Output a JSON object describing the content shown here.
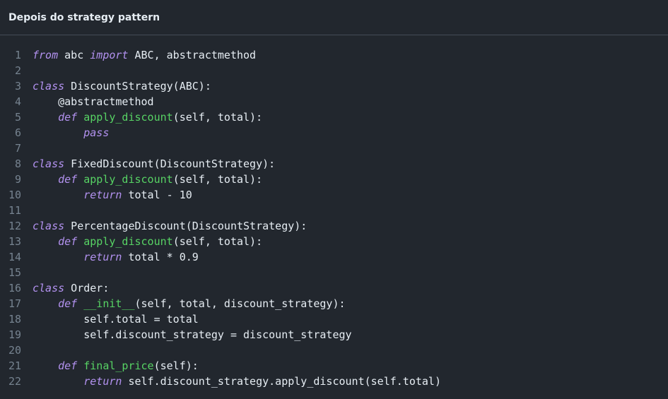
{
  "header": {
    "title": "Depois do strategy pattern"
  },
  "code_lines": [
    {
      "n": "1",
      "tokens": [
        {
          "t": "kw",
          "v": "from"
        },
        {
          "t": "plain",
          "v": " abc "
        },
        {
          "t": "kw",
          "v": "import"
        },
        {
          "t": "plain",
          "v": " ABC, abstractmethod"
        }
      ]
    },
    {
      "n": "2",
      "tokens": []
    },
    {
      "n": "3",
      "tokens": [
        {
          "t": "kw",
          "v": "class"
        },
        {
          "t": "plain",
          "v": " DiscountStrategy(ABC):"
        }
      ]
    },
    {
      "n": "4",
      "tokens": [
        {
          "t": "plain",
          "v": "    @abstractmethod"
        }
      ]
    },
    {
      "n": "5",
      "tokens": [
        {
          "t": "plain",
          "v": "    "
        },
        {
          "t": "kw",
          "v": "def"
        },
        {
          "t": "plain",
          "v": " "
        },
        {
          "t": "fn",
          "v": "apply_discount"
        },
        {
          "t": "plain",
          "v": "(self, total):"
        }
      ]
    },
    {
      "n": "6",
      "tokens": [
        {
          "t": "plain",
          "v": "        "
        },
        {
          "t": "kw",
          "v": "pass"
        }
      ]
    },
    {
      "n": "7",
      "tokens": []
    },
    {
      "n": "8",
      "tokens": [
        {
          "t": "kw",
          "v": "class"
        },
        {
          "t": "plain",
          "v": " FixedDiscount(DiscountStrategy):"
        }
      ]
    },
    {
      "n": "9",
      "tokens": [
        {
          "t": "plain",
          "v": "    "
        },
        {
          "t": "kw",
          "v": "def"
        },
        {
          "t": "plain",
          "v": " "
        },
        {
          "t": "fn",
          "v": "apply_discount"
        },
        {
          "t": "plain",
          "v": "(self, total):"
        }
      ]
    },
    {
      "n": "10",
      "tokens": [
        {
          "t": "plain",
          "v": "        "
        },
        {
          "t": "kw",
          "v": "return"
        },
        {
          "t": "plain",
          "v": " total - 10"
        }
      ]
    },
    {
      "n": "11",
      "tokens": []
    },
    {
      "n": "12",
      "tokens": [
        {
          "t": "kw",
          "v": "class"
        },
        {
          "t": "plain",
          "v": " PercentageDiscount(DiscountStrategy):"
        }
      ]
    },
    {
      "n": "13",
      "tokens": [
        {
          "t": "plain",
          "v": "    "
        },
        {
          "t": "kw",
          "v": "def"
        },
        {
          "t": "plain",
          "v": " "
        },
        {
          "t": "fn",
          "v": "apply_discount"
        },
        {
          "t": "plain",
          "v": "(self, total):"
        }
      ]
    },
    {
      "n": "14",
      "tokens": [
        {
          "t": "plain",
          "v": "        "
        },
        {
          "t": "kw",
          "v": "return"
        },
        {
          "t": "plain",
          "v": " total * 0.9"
        }
      ]
    },
    {
      "n": "15",
      "tokens": []
    },
    {
      "n": "16",
      "tokens": [
        {
          "t": "kw",
          "v": "class"
        },
        {
          "t": "plain",
          "v": " Order:"
        }
      ]
    },
    {
      "n": "17",
      "tokens": [
        {
          "t": "plain",
          "v": "    "
        },
        {
          "t": "kw",
          "v": "def"
        },
        {
          "t": "plain",
          "v": " "
        },
        {
          "t": "fn",
          "v": "__init__"
        },
        {
          "t": "plain",
          "v": "(self, total, discount_strategy):"
        }
      ]
    },
    {
      "n": "18",
      "tokens": [
        {
          "t": "plain",
          "v": "        self.total = total"
        }
      ]
    },
    {
      "n": "19",
      "tokens": [
        {
          "t": "plain",
          "v": "        self.discount_strategy = discount_strategy"
        }
      ]
    },
    {
      "n": "20",
      "tokens": []
    },
    {
      "n": "21",
      "tokens": [
        {
          "t": "plain",
          "v": "    "
        },
        {
          "t": "kw",
          "v": "def"
        },
        {
          "t": "plain",
          "v": " "
        },
        {
          "t": "fn",
          "v": "final_price"
        },
        {
          "t": "plain",
          "v": "(self):"
        }
      ]
    },
    {
      "n": "22",
      "tokens": [
        {
          "t": "plain",
          "v": "        "
        },
        {
          "t": "kw",
          "v": "return"
        },
        {
          "t": "plain",
          "v": " self.discount_strategy.apply_discount(self.total)"
        }
      ]
    }
  ],
  "colors": {
    "background": "#22272e",
    "keyword": "#b392f0",
    "function": "#57d364",
    "text": "#e6edf3",
    "line_number": "#768390"
  }
}
